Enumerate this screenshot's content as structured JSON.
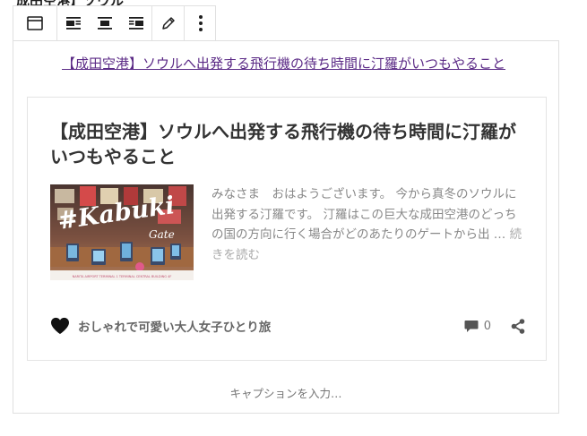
{
  "editor": {
    "heading_text": "成田空港】ソウル",
    "toolbar": {
      "block_type_icon": "embed-block-icon",
      "align_icons": [
        "align-left-icon",
        "align-center-icon",
        "align-right-icon"
      ],
      "edit_icon": "pencil-icon",
      "more_icon": "more-vertical-icon"
    },
    "caption_placeholder": "キャプションを入力…"
  },
  "embed": {
    "link_text": "【成田空港】ソウルへ出発する飛行機の待ち時間に汀羅がいつもやること",
    "card": {
      "title": "【成田空港】ソウルへ出発する飛行機の待ち時間に汀羅がいつもやること",
      "excerpt": "みなさま　おはようございます。 今から真冬のソウルに出発する汀羅です。 汀羅はこの巨大な成田空港のどっちの国の方向に行く場合がどのあたりのゲートから出 …",
      "read_more": "続きを読む",
      "thumbnail_text": {
        "main": "#Kabuki",
        "sub": "Gate",
        "bottom": "NARITA AIRPORT TERMINAL 1 TERMINAL CENTRAL BUILDING 4F"
      },
      "site_name": "おしゃれで可愛い大人女子ひとり旅",
      "comment_count": "0"
    }
  },
  "colors": {
    "link": "#5b2a86",
    "title": "#333333",
    "excerpt": "#888888",
    "border": "#e0e0e0"
  }
}
